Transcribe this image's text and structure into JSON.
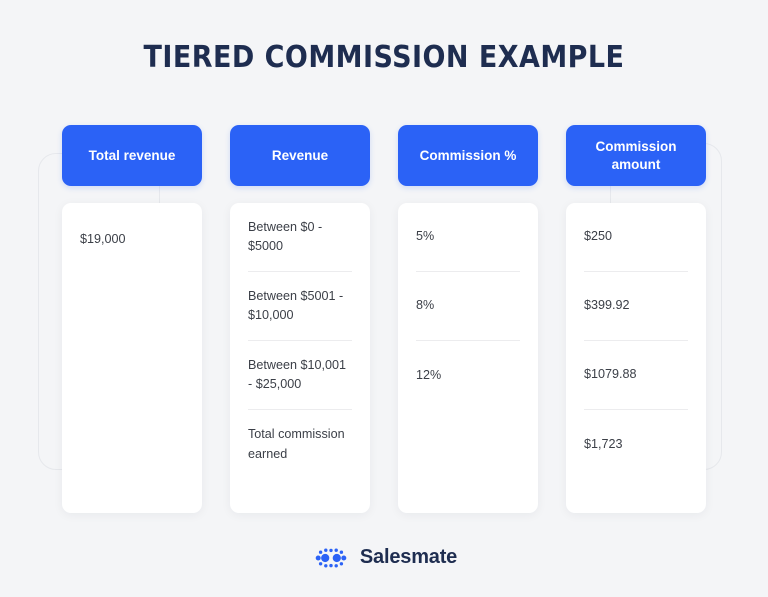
{
  "page": {
    "title": "TIERED COMMISSION EXAMPLE",
    "background_color": "#f4f5f7",
    "accent_color": "#2b62f6",
    "title_color": "#1e2d50"
  },
  "table": {
    "columns": [
      {
        "header": "Total revenue",
        "cells": [
          "$19,000"
        ]
      },
      {
        "header": "Revenue",
        "cells": [
          "Between $0 - $5000",
          "Between $5001 - $10,000",
          "Between $10,001 - $25,000",
          "Total commission earned"
        ]
      },
      {
        "header": "Commission %",
        "cells": [
          "5%",
          "8%",
          "12%"
        ]
      },
      {
        "header": "Commission amount",
        "cells": [
          "$250",
          "$399.92",
          "$1079.88",
          "$1,723"
        ]
      }
    ]
  },
  "footer": {
    "brand_name": "Salesmate",
    "logo_icon": "salesmate-rings-icon",
    "logo_color": "#2b62f6"
  }
}
